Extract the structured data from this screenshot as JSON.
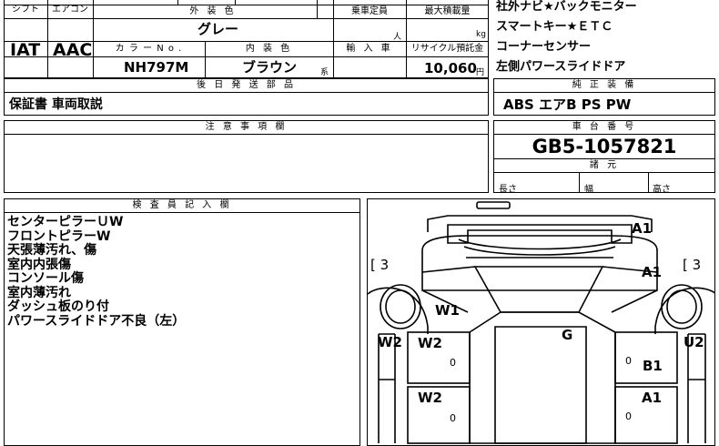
{
  "spec": {
    "shift_label": "シフト",
    "aircon_label": "エアコン",
    "ext_color_label": "外 装 色",
    "capacity_label": "乗車定員",
    "max_load_label": "最大積載量",
    "shift_value": "IAT",
    "aircon_value": "AAC",
    "ext_color_value": "グレー",
    "capacity_unit": "人",
    "max_load_unit": "kg",
    "color_no_label": "カ ラ ー  N o .",
    "interior_color_label": "内 装 色",
    "import_label": "輸 入 車",
    "recycle_label": "リサイクル預託金",
    "color_no_value": "NH797M",
    "interior_color_value": "ブラウン",
    "interior_color_suffix": "系",
    "recycle_value": "10,060",
    "recycle_unit": "円"
  },
  "features": [
    "社外ナビ★バックモニター",
    "スマートキー★ＥＴＣ",
    "コーナーセンサー",
    "左側パワースライドドア"
  ],
  "later_parts": {
    "header": "後 日 発 送 部 品",
    "value": "保証書 車両取説"
  },
  "factory_equipment": {
    "header": "純 正 装 備",
    "value": "ABS  エアB  PS  PW"
  },
  "notes": {
    "header": "注 意 事 項 欄"
  },
  "chassis": {
    "header": "車 台 番 号",
    "value": "GB5-1057821"
  },
  "dimensions": {
    "header": "諸 元",
    "length_label": "長さ",
    "width_label": "幅",
    "height_label": "高さ"
  },
  "inspector": {
    "header": "検 査 員 記 入 欄",
    "remarks": [
      "センターピラーＵW",
      "フロントピラーW",
      "天張薄汚れ、傷",
      "室内内張傷",
      "コンソール傷",
      "室内薄汚れ",
      "ダッシュ板のり付",
      "パワースライドドア不良（左）"
    ]
  },
  "diagram": {
    "marks": {
      "a1_top": "A1",
      "a1_right_front": "A1",
      "left_bracket": "[ 3",
      "right_bracket": "[ 3",
      "w1": "W1",
      "w2_left_outer": "W2",
      "w2_left_inner": "W2",
      "g": "G",
      "u2_right": "U2",
      "b1": "B1",
      "w2_left_lower": "W2",
      "a1_right_lower": "A1"
    },
    "zeros": {
      "z1": "0",
      "z2": "0",
      "z3": "0",
      "z4": "0"
    }
  }
}
